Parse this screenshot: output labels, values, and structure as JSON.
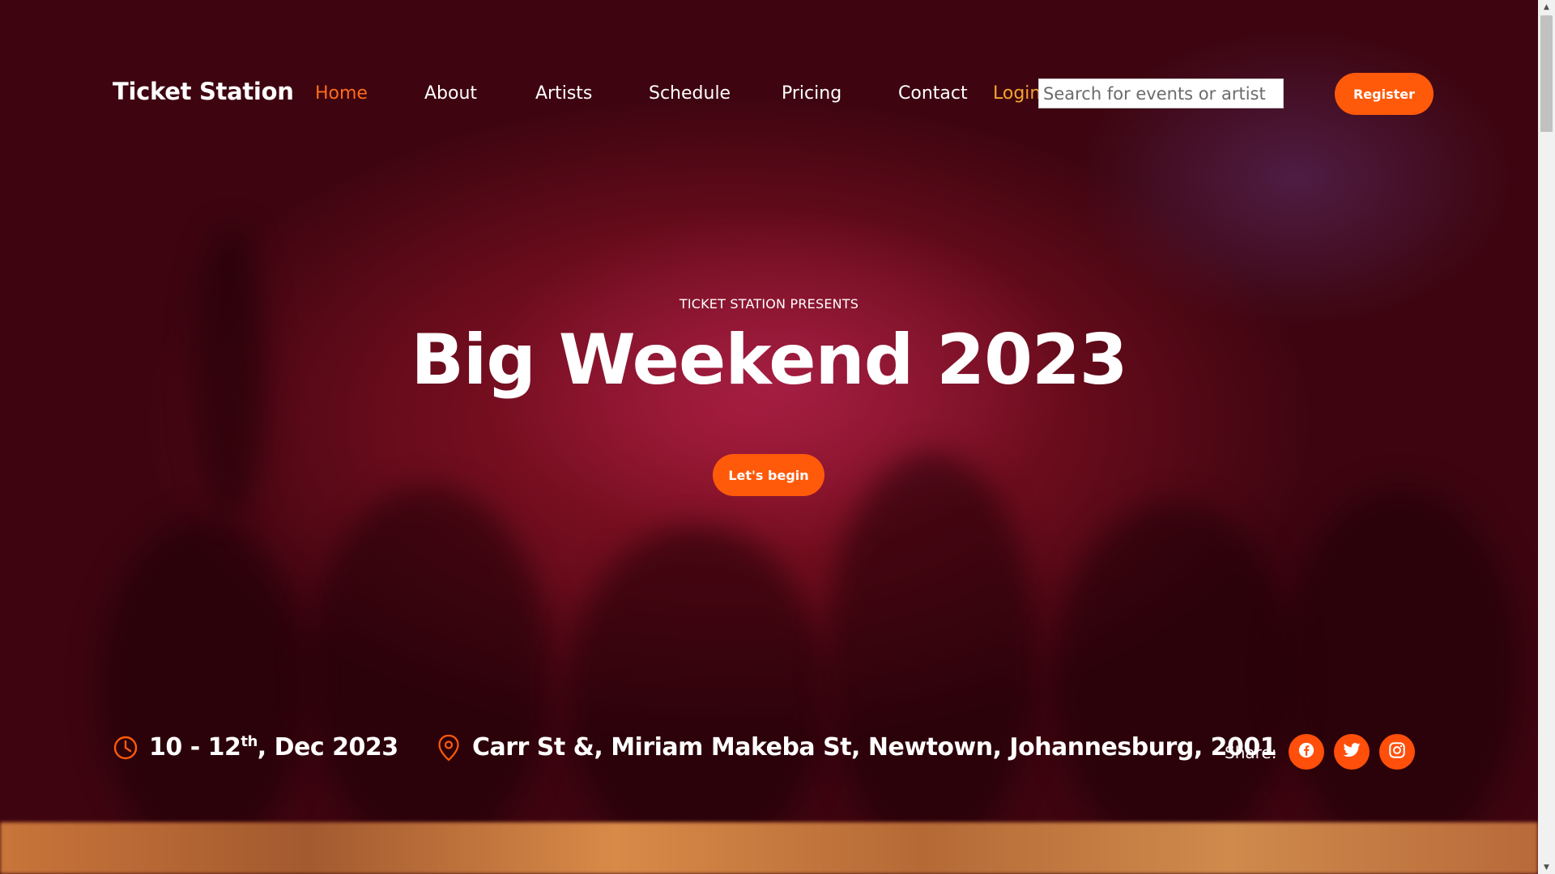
{
  "brand": {
    "name": "Ticket Station"
  },
  "nav": {
    "links": [
      {
        "label": "Home",
        "active": true
      },
      {
        "label": "About"
      },
      {
        "label": "Artists"
      },
      {
        "label": "Schedule"
      },
      {
        "label": "Pricing"
      },
      {
        "label": "Contact"
      }
    ],
    "login_label": "Login",
    "search": {
      "value": "",
      "placeholder": "Search for events or artist"
    },
    "register_label": "Register"
  },
  "hero": {
    "presents": "TICKET STATION PRESENTS",
    "title": "Big Weekend 2023",
    "cta_label": "Let's begin"
  },
  "event_info": {
    "date_prefix": "10 - 12",
    "date_sup": "th",
    "date_suffix": ", Dec 2023",
    "date_icon": "clock-icon",
    "venue": "Carr St &, Miriam Makeba St, Newtown, Johannesburg, 2001",
    "venue_icon": "map-pin-icon"
  },
  "share": {
    "label": "Share:",
    "networks": [
      "facebook-icon",
      "twitter-icon",
      "instagram-icon"
    ]
  },
  "colors": {
    "accent": "#ff5a0a",
    "active_nav": "#ff6b1a",
    "login": "#f4a532",
    "hero_bg": "#6a0c1c"
  }
}
